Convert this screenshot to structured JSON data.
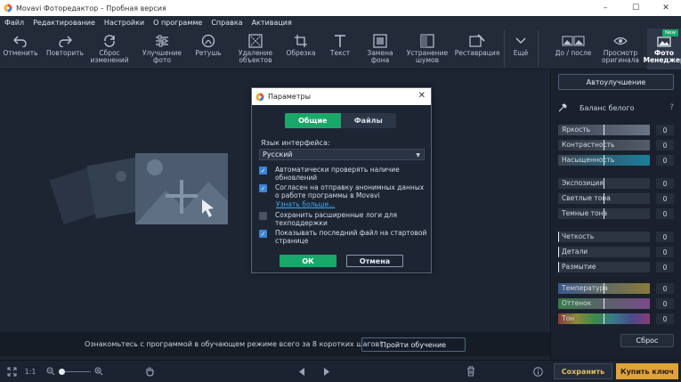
{
  "window": {
    "title": "Movavi Фоторедактор – Пробная версия",
    "controls": [
      "–",
      "☐",
      "✕"
    ]
  },
  "menu": [
    "Файл",
    "Редактирование",
    "Настройки",
    "О программе",
    "Справка",
    "Активация"
  ],
  "toolbar": {
    "tools": [
      {
        "label": "Отменить",
        "icon": "undo-icon"
      },
      {
        "label": "Повторить",
        "icon": "redo-icon"
      },
      {
        "label": "Сброс изменений",
        "icon": "reset-icon"
      },
      {
        "label": "Улучшение фото",
        "icon": "sliders-icon"
      },
      {
        "label": "Ретушь",
        "icon": "retouch-icon"
      },
      {
        "label": "Удаление объектов",
        "icon": "object-removal-icon"
      },
      {
        "label": "Обрезка",
        "icon": "crop-icon"
      },
      {
        "label": "Текст",
        "icon": "text-icon"
      },
      {
        "label": "Замена фона",
        "icon": "background-icon"
      },
      {
        "label": "Устранение шумов",
        "icon": "denoise-icon"
      },
      {
        "label": "Реставрация",
        "icon": "restoration-icon"
      },
      {
        "label": "Ещё",
        "icon": "chevron-down-icon"
      },
      {
        "label": "До / после",
        "icon": "before-after-icon"
      },
      {
        "label": "Просмотр оригинала",
        "icon": "eye-icon"
      },
      {
        "label": "Фото Менеджер",
        "icon": "photo-manager-icon",
        "badge": "New"
      }
    ]
  },
  "banner": {
    "text": "Ознакомьтесь с программой в обучающем режиме всего за 8 коротких шагов!",
    "button": "Пройти обучение"
  },
  "right_panel": {
    "auto_button": "Автоулучшение",
    "white_balance": "Баланс белого",
    "help": "?",
    "groups": [
      [
        {
          "label": "Яркость",
          "value": "0",
          "fill": "#6b7484"
        },
        {
          "label": "Контрастность",
          "value": "0",
          "fill": "#545c69"
        },
        {
          "label": "Насыщенность",
          "value": "0",
          "fill": "#1b7f9b"
        }
      ],
      [
        {
          "label": "Экспозиция",
          "value": "0",
          "fill": "#3a4250"
        },
        {
          "label": "Светлые тона",
          "value": "0",
          "fill": "#3a4250"
        },
        {
          "label": "Темные тона",
          "value": "0",
          "fill": "#3a4250"
        }
      ],
      [
        {
          "label": "Четкость",
          "value": "0",
          "fill": "#3a4250"
        },
        {
          "label": "Детали",
          "value": "0",
          "fill": "#3a4250"
        },
        {
          "label": "Размытие",
          "value": "0",
          "fill": "#3a4250"
        }
      ],
      [
        {
          "label": "Температура",
          "value": "0",
          "fill": "#8a7a3a"
        },
        {
          "label": "Оттенок",
          "value": "0",
          "fill": "#7a4a8a"
        },
        {
          "label": "Тон",
          "value": "0",
          "fill": "#6a9a6a"
        }
      ]
    ],
    "reset": "Сброс"
  },
  "dialog": {
    "title": "Параметры",
    "tab_general": "Общие",
    "tab_files": "Файлы",
    "language_label": "Язык интерфейса:",
    "language_value": "Русский",
    "options": [
      {
        "text": "Автоматически проверять наличие обновлений",
        "checked": true
      },
      {
        "text": "Согласен на отправку анонимных данных о работе программы в Movavi",
        "checked": true
      },
      {
        "text": "Сохранить расширенные логи для техподдержки",
        "checked": false
      },
      {
        "text": "Показывать последний файл на стартовой странице",
        "checked": true
      }
    ],
    "learn_more": "Узнать больше...",
    "ok": "ОК",
    "cancel": "Отмена"
  },
  "bottom": {
    "zoom_ratio": "1:1",
    "save": "Сохранить",
    "buy": "Купить ключ"
  },
  "colors": {
    "accent_green": "#1aa86a",
    "buy_orange": "#e0a23a",
    "link_blue": "#3fa9f5"
  }
}
